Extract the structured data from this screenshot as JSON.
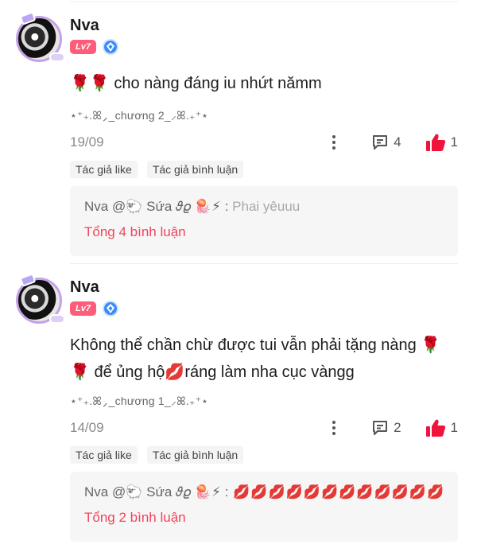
{
  "comments": [
    {
      "username": "Nva",
      "level": "Lv7",
      "content": "🌹🌹 cho nàng đáng iu nhứt nămm",
      "chapter": "⋆⁺₊.ꕤ⸝_chương 2_⸝ꕤ.₊⁺⋆",
      "date": "19/09",
      "reply_count": "4",
      "like_count": "1",
      "tags": [
        "Tác giả like",
        "Tác giả bình luận"
      ],
      "reply": {
        "author": "Nva @🐑 Sứa 𝜗𝜚 🪼⚡ :",
        "text": " Phai yêuuu"
      },
      "total_label": "Tổng 4 bình luận"
    },
    {
      "username": "Nva",
      "level": "Lv7",
      "content": "Không thể chần chừ được tui vẫn phải tặng nàng 🌹 🌹 để ủng hộ💋ráng làm nha cục vàngg",
      "chapter": "⋆⁺₊.ꕤ⸝_chương 1_⸝ꕤ.₊⁺⋆",
      "date": "14/09",
      "reply_count": "2",
      "like_count": "1",
      "tags": [
        "Tác giả like",
        "Tác giả bình luận"
      ],
      "reply": {
        "author": "Nva @🐑 Sứa 𝜗𝜚 🪼⚡ :",
        "text": " 💋💋💋💋💋💋💋💋💋💋💋💋💋"
      },
      "total_label": "Tổng 2 bình luận"
    }
  ],
  "colors": {
    "accent": "#f2445c",
    "like": "#f0143c",
    "level_badge": "#ff5c7a",
    "vip_icon": "#3a8bfa",
    "avatar_ring": "#c7a1e6"
  },
  "icons": {
    "more": "vertical-ellipsis-icon",
    "reply": "comment-bubble-icon",
    "like": "thumbs-up-icon",
    "vip": "diamond-vip-icon"
  }
}
